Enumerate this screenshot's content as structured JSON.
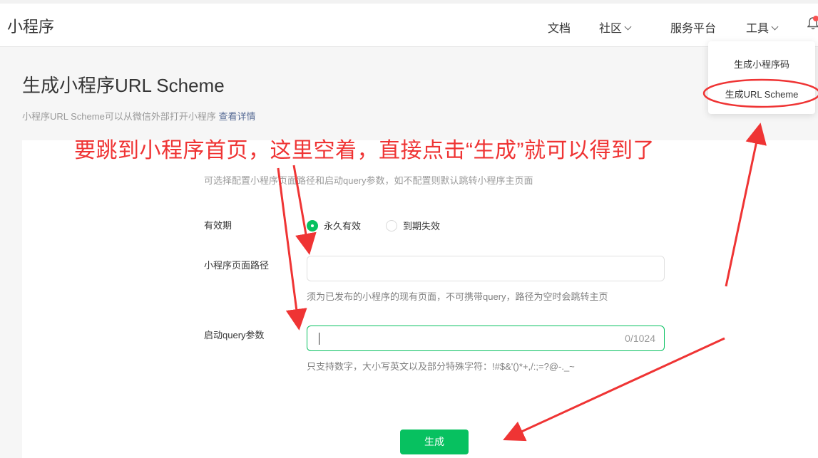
{
  "header": {
    "brand": "小程序",
    "nav": {
      "docs": "文档",
      "community": "社区",
      "services": "服务平台",
      "tools": "工具"
    }
  },
  "tools_menu": {
    "items": [
      "生成小程序码",
      "生成URL Scheme"
    ]
  },
  "page": {
    "title": "生成小程序URL Scheme",
    "desc": "小程序URL Scheme可以从微信外部打开小程序",
    "desc_link": "查看详情"
  },
  "form": {
    "tip": "可选择配置小程序页面路径和启动query参数，如不配置则默认跳转小程序主页面",
    "validity": {
      "label": "有效期",
      "options": [
        "永久有效",
        "到期失效"
      ],
      "selected": "永久有效"
    },
    "path": {
      "label": "小程序页面路径",
      "value": "",
      "hint": "须为已发布的小程序的现有页面，不可携带query，路径为空时会跳转主页"
    },
    "query": {
      "label": "启动query参数",
      "value": "",
      "counter": "0/1024",
      "hint": "只支持数字，大小写英文以及部分特殊字符：!#$&'()*+,/:;=?@-._~"
    },
    "generate_label": "生成"
  },
  "annotation": {
    "text": "要跳到小程序首页，这里空着，直接点击“生成”就可以得到了",
    "color": "#ef3434"
  },
  "colors": {
    "accent": "#07c160",
    "link": "#576b95"
  }
}
